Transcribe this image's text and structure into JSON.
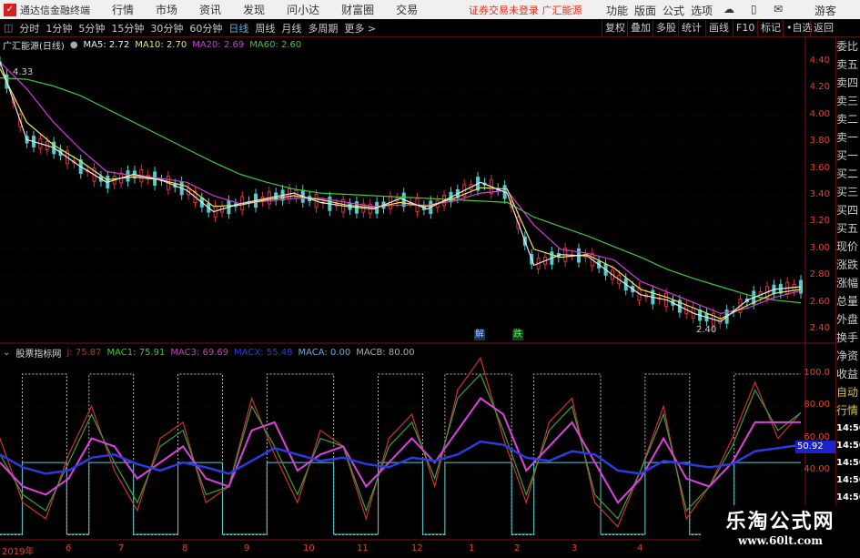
{
  "app": {
    "name": "通达信金融终端",
    "logo_icon": "tdx-logo-icon"
  },
  "menu": [
    "行情",
    "市场",
    "资讯",
    "发现",
    "问小达",
    "财富圈",
    "交易"
  ],
  "login_status": "证券交易未登录  广汇能源",
  "right_menu": [
    "功能",
    "版面",
    "公式",
    "选项",
    "游客"
  ],
  "periods": [
    "分时",
    "1分钟",
    "5分钟",
    "15分钟",
    "30分钟",
    "60分钟",
    "日线",
    "周线",
    "月线",
    "多周期",
    "更多 >"
  ],
  "active_period": "日线",
  "tools": [
    "复权",
    "叠加",
    "多股",
    "统计",
    "画线",
    "F10",
    "标记",
    "•自选",
    "返回"
  ],
  "main_info": {
    "title": "广汇能源(日线)",
    "ma5": "MA5: 2.72",
    "ma10": "MA10: 2.70",
    "ma20": "MA20: 2.69",
    "ma60": "MA60: 2.60"
  },
  "ind_info": {
    "title": "股票指标网",
    "j": "J: 75.87",
    "mac1": "MAC1: 75.91",
    "mac3": "MAC3: 69.69",
    "macx": "MACX: 55.48",
    "maca": "MACA: 0.00",
    "macb": "MACB: 80.00"
  },
  "price_labels": [
    "4.40",
    "4.20",
    "4.00",
    "3.80",
    "3.60",
    "3.40",
    "3.20",
    "3.00",
    "2.80",
    "2.60",
    "2.40"
  ],
  "ind_labels": [
    "100.0",
    "80.00",
    "60.00",
    "40.00"
  ],
  "last_value": "50.92",
  "annotations": {
    "high": "4.33",
    "low": "2.40",
    "mark1": "解",
    "mark2": "跌"
  },
  "x_labels": [
    "2019年",
    "6",
    "7",
    "8",
    "9",
    "10",
    "11",
    "12",
    "1",
    "2",
    "3",
    "4"
  ],
  "side": [
    "委比",
    "卖五",
    "卖四",
    "卖三",
    "卖二",
    "卖一",
    "买一",
    "买二",
    "买三",
    "买四",
    "买五",
    "现价",
    "涨跌",
    "涨幅",
    "总量",
    "外盘",
    "换手",
    "净资",
    "收益",
    "自动",
    "行情",
    "14:50",
    "14:50",
    "14:50",
    "14:50",
    "14:50",
    "14:50",
    "14:50",
    "14:50"
  ],
  "watermark": {
    "title": "乐淘公式网",
    "url": "www.60lt.com"
  },
  "colors": {
    "ma5": "#e8e8e8",
    "ma10": "#e6e65a",
    "ma20": "#d23cd2",
    "ma60": "#3cc83c",
    "j": "#d03030",
    "mac1": "#3ca03c",
    "mac3": "#e040e0",
    "maca": "#2a3ce0"
  },
  "chart_data": {
    "type": "line",
    "price_range": [
      2.4,
      4.4
    ],
    "ma5": [
      4.4,
      3.82,
      3.76,
      3.62,
      3.5,
      3.56,
      3.52,
      3.44,
      3.28,
      3.34,
      3.38,
      3.42,
      3.35,
      3.32,
      3.3,
      3.38,
      3.3,
      3.4,
      3.5,
      3.42,
      2.88,
      2.96,
      2.95,
      2.8,
      2.66,
      2.62,
      2.52,
      2.46,
      2.62,
      2.7,
      2.72
    ],
    "ma10": [
      4.35,
      3.95,
      3.78,
      3.66,
      3.52,
      3.54,
      3.52,
      3.47,
      3.32,
      3.33,
      3.37,
      3.4,
      3.37,
      3.33,
      3.31,
      3.35,
      3.32,
      3.38,
      3.46,
      3.45,
      3.0,
      2.94,
      2.96,
      2.86,
      2.7,
      2.64,
      2.56,
      2.48,
      2.58,
      2.67,
      2.7
    ],
    "ma20": [
      4.4,
      4.2,
      3.95,
      3.75,
      3.58,
      3.55,
      3.53,
      3.5,
      3.4,
      3.34,
      3.36,
      3.38,
      3.38,
      3.35,
      3.32,
      3.33,
      3.33,
      3.36,
      3.42,
      3.44,
      3.18,
      3.0,
      2.97,
      2.92,
      2.76,
      2.68,
      2.6,
      2.52,
      2.56,
      2.64,
      2.69
    ],
    "ma60": [
      4.28,
      4.27,
      4.22,
      4.15,
      4.05,
      3.95,
      3.85,
      3.75,
      3.65,
      3.56,
      3.5,
      3.45,
      3.42,
      3.41,
      3.4,
      3.39,
      3.38,
      3.37,
      3.36,
      3.35,
      3.24,
      3.17,
      3.1,
      3.02,
      2.94,
      2.85,
      2.78,
      2.72,
      2.66,
      2.62,
      2.6
    ],
    "ind_range": [
      0,
      115
    ],
    "j": [
      60,
      20,
      10,
      50,
      80,
      40,
      15,
      60,
      70,
      20,
      30,
      85,
      50,
      20,
      65,
      55,
      10,
      60,
      75,
      30,
      90,
      110,
      60,
      20,
      70,
      85,
      20,
      5,
      40,
      80,
      10,
      30,
      60,
      95,
      60,
      76
    ],
    "mac1": [
      50,
      25,
      15,
      45,
      75,
      45,
      20,
      55,
      65,
      25,
      30,
      80,
      55,
      25,
      60,
      55,
      15,
      55,
      70,
      35,
      85,
      100,
      65,
      25,
      65,
      80,
      25,
      10,
      40,
      75,
      15,
      30,
      55,
      90,
      65,
      76
    ],
    "mac3": [
      45,
      30,
      25,
      35,
      60,
      55,
      35,
      45,
      55,
      35,
      30,
      65,
      70,
      40,
      50,
      55,
      30,
      45,
      60,
      45,
      65,
      85,
      75,
      40,
      55,
      70,
      45,
      20,
      35,
      60,
      35,
      30,
      45,
      70,
      70,
      70
    ],
    "maca_line": [
      50,
      42,
      38,
      40,
      48,
      50,
      44,
      40,
      45,
      42,
      38,
      46,
      54,
      50,
      46,
      48,
      44,
      42,
      48,
      46,
      50,
      58,
      56,
      48,
      46,
      52,
      50,
      40,
      38,
      46,
      44,
      42,
      44,
      52,
      54,
      56
    ],
    "step": [
      0,
      80,
      80,
      0,
      80,
      80,
      0,
      0,
      80,
      80,
      0,
      0,
      80,
      80,
      80,
      0,
      0,
      80,
      80,
      0,
      80,
      80,
      80,
      0,
      80,
      80,
      80,
      0,
      0,
      80,
      80,
      0,
      0,
      80,
      80,
      80
    ]
  }
}
